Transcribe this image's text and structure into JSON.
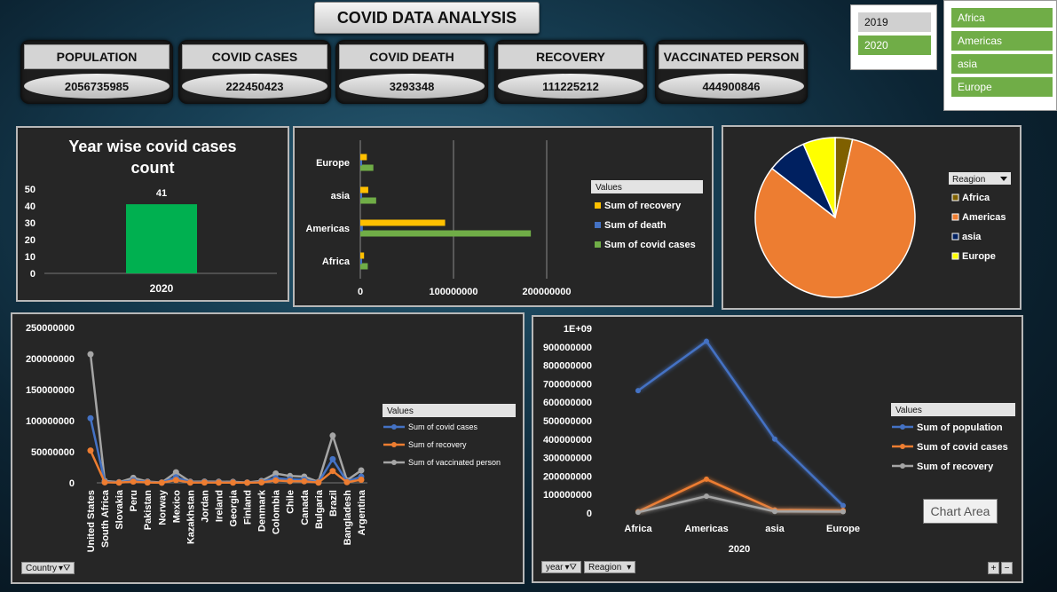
{
  "header": {
    "title": "COVID DATA ANALYSIS"
  },
  "kpis": [
    {
      "label": "POPULATION",
      "value": "2056735985"
    },
    {
      "label": "COVID CASES",
      "value": "222450423"
    },
    {
      "label": "COVID DEATH",
      "value": "3293348"
    },
    {
      "label": "RECOVERY",
      "value": "111225212"
    },
    {
      "label": "VACCINATED PERSON",
      "value": "444900846"
    }
  ],
  "slicers": {
    "year": [
      "2019",
      "2020"
    ],
    "region": [
      "Africa",
      "Americas",
      "asia",
      "Europe"
    ]
  },
  "colors": {
    "green": "#00b050",
    "slicer_green": "#70ad47",
    "blue": "#4472c4",
    "orange": "#ed7d31",
    "grey": "#a5a5a5",
    "yellow": "#ffc000",
    "navy": "#002060",
    "bright_yellow": "#ffff00",
    "olive": "#7f6000"
  },
  "chart_data": [
    {
      "type": "bar",
      "title": "Year wise covid cases count",
      "categories": [
        "2020"
      ],
      "values": [
        41
      ],
      "ylim": [
        0,
        50
      ],
      "yticks": [
        "50",
        "40",
        "30",
        "20",
        "10",
        "0"
      ]
    },
    {
      "type": "bar",
      "orientation": "horizontal",
      "categories": [
        "Africa",
        "Americas",
        "asia",
        "Europe"
      ],
      "legend_title": "Values",
      "series": [
        {
          "name": "Sum of covid cases",
          "values": [
            8000000,
            183000000,
            17000000,
            14000000
          ]
        },
        {
          "name": "Sum of death",
          "values": [
            300000,
            2700000,
            250000,
            150000
          ]
        },
        {
          "name": "Sum of recovery",
          "values": [
            4000000,
            91000000,
            8500000,
            7000000
          ]
        }
      ],
      "xlim": [
        0,
        200000000
      ],
      "xticks": [
        "0",
        "100000000",
        "200000000"
      ]
    },
    {
      "type": "pie",
      "legend_title": "Reagion",
      "categories": [
        "Africa",
        "Americas",
        "asia",
        "Europe"
      ],
      "values": [
        3.5,
        82,
        8,
        6.5
      ]
    },
    {
      "type": "line",
      "legend_title": "Values",
      "filter_label": "Country",
      "x": [
        "United States",
        "South Africa",
        "Slovakia",
        "Peru",
        "Pakistan",
        "Norway",
        "Mexico",
        "Kazakhstan",
        "Jordan",
        "Ireland",
        "Georgia",
        "Finland",
        "Denmark",
        "Colombia",
        "Chile",
        "Canada",
        "Bulgaria",
        "Brazil",
        "Bangladesh",
        "Argentina"
      ],
      "series": [
        {
          "name": "Sum of covid cases",
          "values": [
            104000000,
            1500000,
            500000,
            4000000,
            1000000,
            300000,
            9000000,
            900000,
            1000000,
            900000,
            800000,
            300000,
            1500000,
            7500000,
            5500000,
            5000000,
            800000,
            38000000,
            2000000,
            10000000
          ]
        },
        {
          "name": "Sum of recovery",
          "values": [
            52000000,
            800000,
            300000,
            2000000,
            500000,
            150000,
            4500000,
            400000,
            500000,
            400000,
            400000,
            150000,
            700000,
            3800000,
            2700000,
            2500000,
            400000,
            19000000,
            1000000,
            5000000
          ]
        },
        {
          "name": "Sum of vaccinated person",
          "values": [
            207000000,
            3000000,
            1000000,
            8000000,
            2000000,
            600000,
            17000000,
            1800000,
            2000000,
            1800000,
            1600000,
            600000,
            3000000,
            15000000,
            11000000,
            10000000,
            1600000,
            76000000,
            4000000,
            20000000
          ]
        }
      ],
      "ylim": [
        0,
        250000000
      ],
      "yticks": [
        "250000000",
        "200000000",
        "150000000",
        "100000000",
        "50000000",
        "0"
      ]
    },
    {
      "type": "line",
      "legend_title": "Values",
      "filter_labels": [
        "year",
        "Reagion"
      ],
      "xlabel": "2020",
      "x": [
        "Africa",
        "Americas",
        "asia",
        "Europe"
      ],
      "series": [
        {
          "name": "Sum of population",
          "values": [
            663000000,
            930000000,
            400000000,
            40000000
          ]
        },
        {
          "name": "Sum of covid cases",
          "values": [
            8000000,
            183000000,
            17000000,
            14000000
          ]
        },
        {
          "name": "Sum of recovery",
          "values": [
            4000000,
            91000000,
            8500000,
            7000000
          ]
        }
      ],
      "ylim": [
        0,
        1000000000
      ],
      "yticks": [
        "1E+09",
        "900000000",
        "800000000",
        "700000000",
        "600000000",
        "500000000",
        "400000000",
        "300000000",
        "200000000",
        "100000000",
        "0"
      ],
      "tooltip": "Chart Area"
    }
  ]
}
